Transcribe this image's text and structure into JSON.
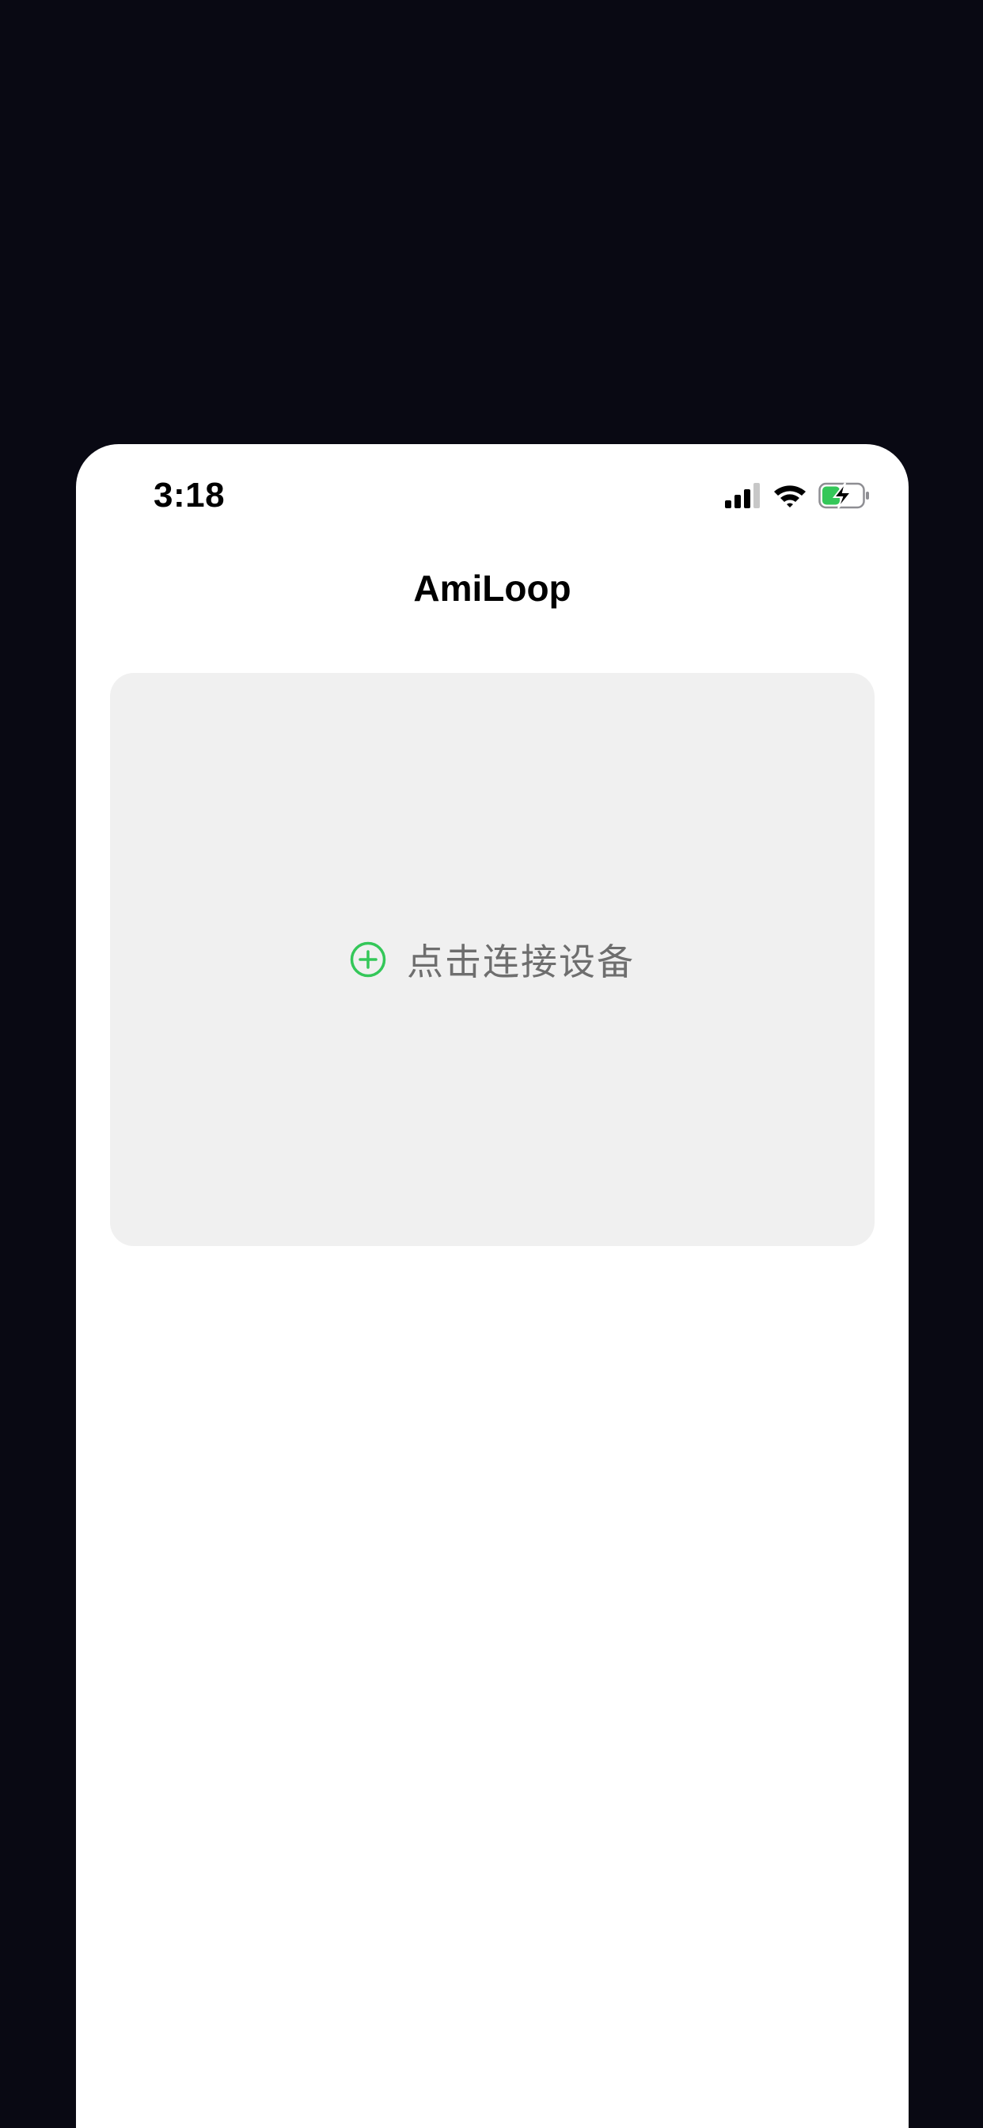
{
  "status_bar": {
    "time": "3:18",
    "icons": [
      "cellular-signal-icon",
      "wifi-icon",
      "battery-charging-icon"
    ]
  },
  "nav": {
    "title": "AmiLoop"
  },
  "connect_card": {
    "icon": "add-circle-icon",
    "label": "点击连接设备"
  },
  "colors": {
    "page_background": "#090913",
    "sheet_background": "#ffffff",
    "card_background": "#f0f0f0",
    "accent_green": "#34c759",
    "label_gray": "#6e6e6e"
  }
}
